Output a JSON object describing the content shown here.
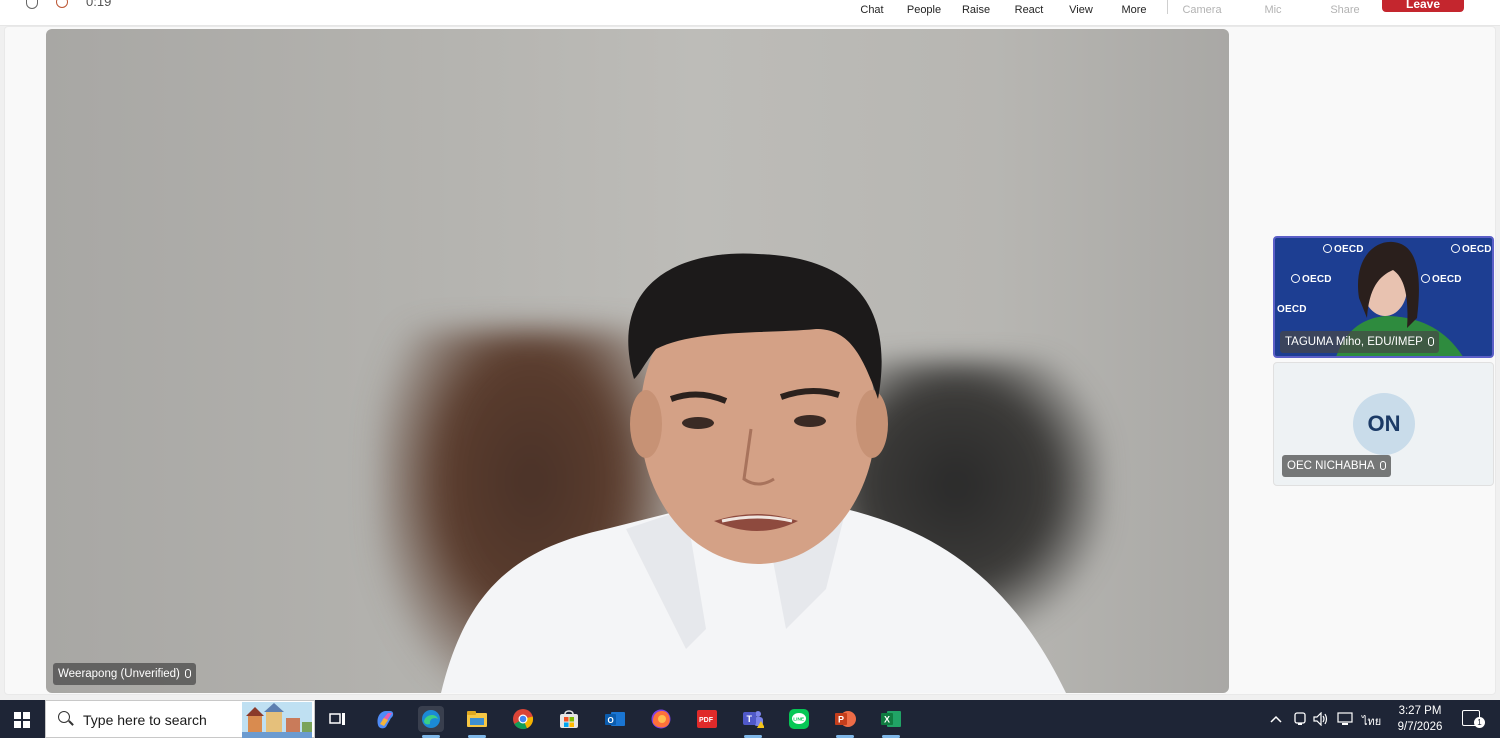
{
  "toolbar": {
    "timer": "0:19",
    "buttons": {
      "chat": "Chat",
      "people": "People",
      "raise": "Raise",
      "react": "React",
      "view": "View",
      "more": "More",
      "camera": "Camera",
      "mic": "Mic",
      "share": "Share"
    },
    "leave_label": "Leave",
    "leave_color": "#c4262e"
  },
  "main_video": {
    "participant_name": "Weerapong (Unverified)"
  },
  "participants": [
    {
      "name": "TAGUMA Miho, EDU/IMEP",
      "background_logos": [
        "OECD",
        "OECD",
        "OECD",
        "OECD",
        "OECD"
      ],
      "active_border_color": "#5b5fc7"
    },
    {
      "name": "OEC NICHABHA",
      "initials": "ON"
    }
  ],
  "taskbar": {
    "search_placeholder": "Type here to search",
    "apps": [
      "task-view",
      "copilot",
      "edge",
      "file-explorer",
      "chrome",
      "microsoft-store",
      "outlook",
      "firefox",
      "pdf",
      "teams",
      "line",
      "powerpoint",
      "excel"
    ],
    "language": "ไทย",
    "time": "3:27 PM",
    "date": "9/7/2026",
    "notification_count": "1"
  }
}
